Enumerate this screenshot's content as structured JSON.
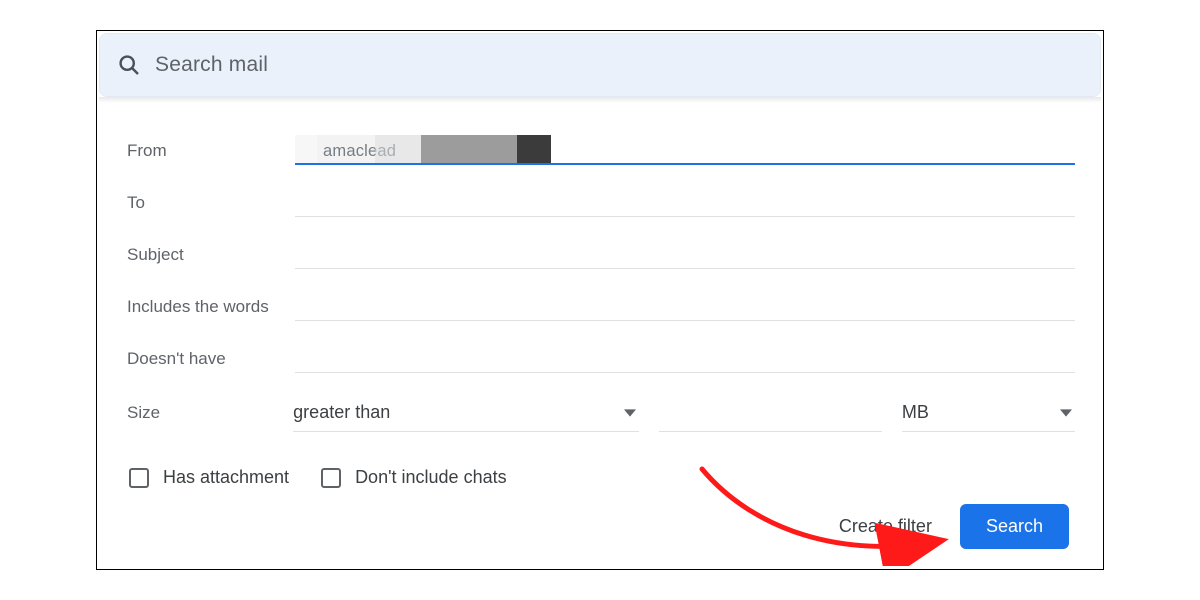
{
  "searchbar": {
    "placeholder": "Search mail",
    "icon": "search-icon"
  },
  "form": {
    "from": {
      "label": "From",
      "value": "amaclead"
    },
    "to": {
      "label": "To",
      "value": ""
    },
    "subject": {
      "label": "Subject",
      "value": ""
    },
    "includes": {
      "label": "Includes the words",
      "value": ""
    },
    "excludes": {
      "label": "Doesn't have",
      "value": ""
    },
    "size": {
      "label": "Size",
      "comparator": "greater than",
      "amount": "",
      "unit": "MB"
    },
    "has_attachment": {
      "label": "Has attachment",
      "checked": false
    },
    "exclude_chats": {
      "label": "Don't include chats",
      "checked": false
    }
  },
  "footer": {
    "create_filter": "Create filter",
    "search": "Search"
  },
  "annotation": {
    "arrow_target": "create-filter"
  },
  "colors": {
    "accent": "#1a73e8",
    "searchbar_bg": "#eaf1fb",
    "text_muted": "#5f6368"
  }
}
